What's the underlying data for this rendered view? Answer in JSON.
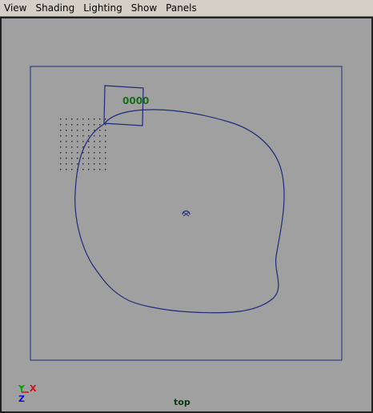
{
  "menubar": {
    "items": [
      {
        "label": "View"
      },
      {
        "label": "Shading"
      },
      {
        "label": "Lighting"
      },
      {
        "label": "Show"
      },
      {
        "label": "Panels"
      }
    ]
  },
  "viewport": {
    "camera_name": "top",
    "frame_number": "0000",
    "axis": {
      "y": "Y",
      "x": "X",
      "z": "Z"
    },
    "colors": {
      "background": "#a0a0a0",
      "curve": "#1f2a7a",
      "frame_text": "#1a6b1a",
      "axis_x": "#d01010",
      "axis_y": "#10a010",
      "axis_z": "#1010d0"
    }
  }
}
